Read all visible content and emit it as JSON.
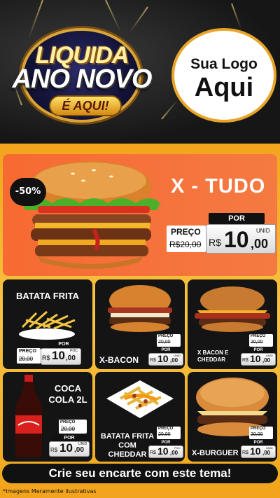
{
  "header": {
    "badge": {
      "line1": "LIQUIDA",
      "line2": "ANO NOVO",
      "pill": "É AQUI!"
    },
    "logo": {
      "line1": "Sua Logo",
      "line2": "Aqui"
    }
  },
  "hero": {
    "title": "X - TUDO",
    "discount": "-50%",
    "price": {
      "por": "POR",
      "preco": "PREÇO",
      "old": "R$20,00",
      "currency": "R$",
      "value": "10",
      "cents": ",00",
      "unit": "UNID"
    }
  },
  "cards": [
    {
      "id": "batata-frita",
      "title": "BATATA FRITA",
      "price": {
        "por": "POR",
        "preco": "PREÇO",
        "old": "20,00",
        "currency": "R$",
        "value": "10",
        "cents": ",00",
        "unit": "POC"
      }
    },
    {
      "id": "x-bacon",
      "title": "X-BACON",
      "price": {
        "por": "POR",
        "preco": "PREÇO",
        "old": "20,00",
        "currency": "R$",
        "value": "10",
        "cents": ",00",
        "unit": "UNID"
      }
    },
    {
      "id": "x-bacon-cheddar",
      "title": "X BACON E CHEDDAR",
      "price": {
        "por": "POR",
        "preco": "PREÇO",
        "old": "20,00",
        "currency": "R$",
        "value": "10",
        "cents": ",00",
        "unit": "UNID"
      }
    },
    {
      "id": "coca-cola",
      "title": "COCA COLA 2L",
      "price": {
        "por": "POR",
        "preco": "PREÇO",
        "old": "20,00",
        "currency": "R$",
        "value": "10",
        "cents": ",00",
        "unit": "UNID"
      }
    },
    {
      "id": "batata-cheddar",
      "title": "BATATA FRITA COM CHEDDAR",
      "price": {
        "por": "POR",
        "preco": "PREÇO",
        "old": "20,00",
        "currency": "R$",
        "value": "10",
        "cents": ",00",
        "unit": "POC"
      }
    },
    {
      "id": "x-burguer",
      "title": "X-BURGUER",
      "price": {
        "por": "POR",
        "preco": "PREÇO",
        "old": "20,00",
        "currency": "R$",
        "value": "10",
        "cents": ",00",
        "unit": "UNID"
      }
    }
  ],
  "cta": "Crie seu encarte com este tema!",
  "disclaimer": "*Imagens Meramente Ilustrativas",
  "colors": {
    "orange": "#f2a51c",
    "hero": "#f76a32",
    "dark": "#141414",
    "gold": "#e8a52a"
  },
  "icons": [
    "burger-illustration",
    "fries-illustration",
    "soda-bottle-illustration",
    "cheese-fries-illustration",
    "fireworks-decoration"
  ]
}
